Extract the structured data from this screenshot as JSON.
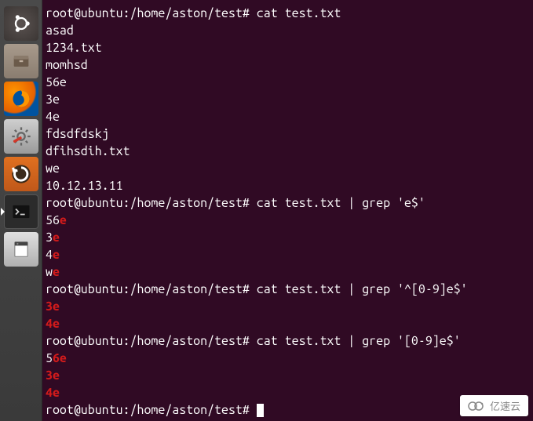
{
  "launcher": {
    "items": [
      {
        "name": "ubuntu-dash-icon"
      },
      {
        "name": "file-manager-icon"
      },
      {
        "name": "firefox-icon"
      },
      {
        "name": "system-settings-icon"
      },
      {
        "name": "software-updater-icon"
      },
      {
        "name": "terminal-icon"
      },
      {
        "name": "text-editor-icon"
      }
    ]
  },
  "terminal": {
    "prompt": "root@ubuntu:/home/aston/test#",
    "blocks": [
      {
        "cmd": "cat test.txt",
        "output": [
          {
            "segments": [
              {
                "t": "asad",
                "hl": false
              }
            ]
          },
          {
            "segments": [
              {
                "t": "1234.txt",
                "hl": false
              }
            ]
          },
          {
            "segments": [
              {
                "t": "momhsd",
                "hl": false
              }
            ]
          },
          {
            "segments": [
              {
                "t": "56e",
                "hl": false
              }
            ]
          },
          {
            "segments": [
              {
                "t": "3e",
                "hl": false
              }
            ]
          },
          {
            "segments": [
              {
                "t": "4e",
                "hl": false
              }
            ]
          },
          {
            "segments": [
              {
                "t": "fdsdfdskj",
                "hl": false
              }
            ]
          },
          {
            "segments": [
              {
                "t": "dfihsdih.txt",
                "hl": false
              }
            ]
          },
          {
            "segments": [
              {
                "t": "we",
                "hl": false
              }
            ]
          },
          {
            "segments": [
              {
                "t": "10.12.13.11",
                "hl": false
              }
            ]
          }
        ]
      },
      {
        "cmd": "cat test.txt | grep 'e$'",
        "output": [
          {
            "segments": [
              {
                "t": "56",
                "hl": false
              },
              {
                "t": "e",
                "hl": true
              }
            ]
          },
          {
            "segments": [
              {
                "t": "3",
                "hl": false
              },
              {
                "t": "e",
                "hl": true
              }
            ]
          },
          {
            "segments": [
              {
                "t": "4",
                "hl": false
              },
              {
                "t": "e",
                "hl": true
              }
            ]
          },
          {
            "segments": [
              {
                "t": "w",
                "hl": false
              },
              {
                "t": "e",
                "hl": true
              }
            ]
          }
        ]
      },
      {
        "cmd": "cat test.txt | grep '^[0-9]e$'",
        "output": [
          {
            "segments": [
              {
                "t": "3e",
                "hl": true
              }
            ]
          },
          {
            "segments": [
              {
                "t": "4e",
                "hl": true
              }
            ]
          }
        ]
      },
      {
        "cmd": "cat test.txt | grep '[0-9]e$'",
        "output": [
          {
            "segments": [
              {
                "t": "5",
                "hl": false
              },
              {
                "t": "6e",
                "hl": true
              }
            ]
          },
          {
            "segments": [
              {
                "t": "3e",
                "hl": true
              }
            ]
          },
          {
            "segments": [
              {
                "t": "4e",
                "hl": true
              }
            ]
          }
        ]
      }
    ],
    "final_cmd": ""
  },
  "watermark": {
    "text": "亿速云"
  }
}
